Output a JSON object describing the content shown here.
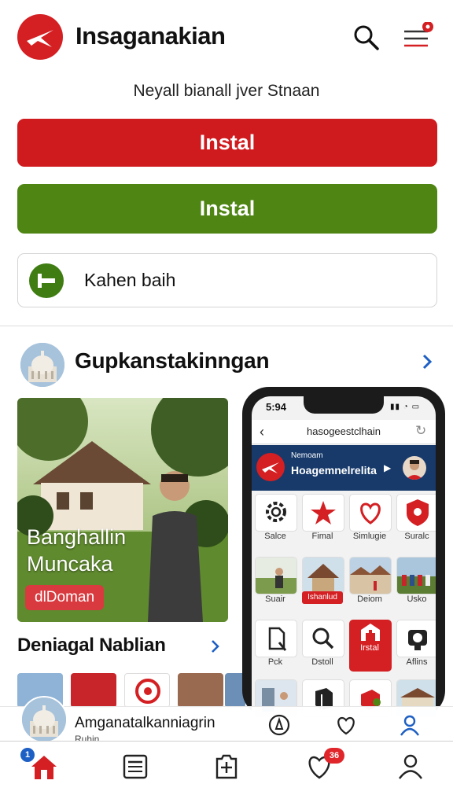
{
  "app": {
    "title": "Insaganakian"
  },
  "subtitle": "Neyall bianall jver Stnaan",
  "buttons": {
    "primary_label": "Instal",
    "secondary_label": "Instal"
  },
  "card": {
    "label": "Kahen baih"
  },
  "section": {
    "title": "Gupkanstakinngan"
  },
  "featured": {
    "title_line1": "Banghallin",
    "title_line2": "Muncaka",
    "badge": "dlDoman"
  },
  "subsection": {
    "title": "Deniagal Nablian"
  },
  "phone": {
    "time": "5:94",
    "status": "▮▮ ◔ ▭",
    "url": "hasogeestclhain",
    "banner_small": "Nemoam",
    "banner_title": "Hoagemnelrelita",
    "tiles": [
      {
        "label": "Salce",
        "icon": "gear-icon"
      },
      {
        "label": "Fimal",
        "icon": "star-icon"
      },
      {
        "label": "Simlugie",
        "icon": "heart-icon"
      },
      {
        "label": "Suralc",
        "icon": "shield-icon"
      },
      {
        "label": "Suair",
        "icon": "photo-people"
      },
      {
        "label": "Ishanlud",
        "icon": "photo-temple"
      },
      {
        "label": "Deiom",
        "icon": "photo-houses"
      },
      {
        "label": "Usko",
        "icon": "photo-crowd"
      },
      {
        "label": "Pck",
        "icon": "document-icon"
      },
      {
        "label": "Dstoll",
        "icon": "magnifier-icon"
      },
      {
        "label": "Irstal",
        "icon": "install-icon"
      },
      {
        "label": "Aflins",
        "icon": "camera-icon"
      }
    ]
  },
  "mini_player": {
    "title": "Amganatalkanniagrin",
    "subtitle": "Ruhin"
  },
  "nav": {
    "home_badge": "1",
    "likes_badge": "36",
    "items": [
      "home-icon",
      "news-icon",
      "add-icon",
      "heart-icon",
      "profile-icon"
    ]
  },
  "colors": {
    "brand_red": "#d41f23",
    "green": "#4f8513",
    "navy": "#173a6b",
    "link_blue": "#1d5fc4"
  }
}
